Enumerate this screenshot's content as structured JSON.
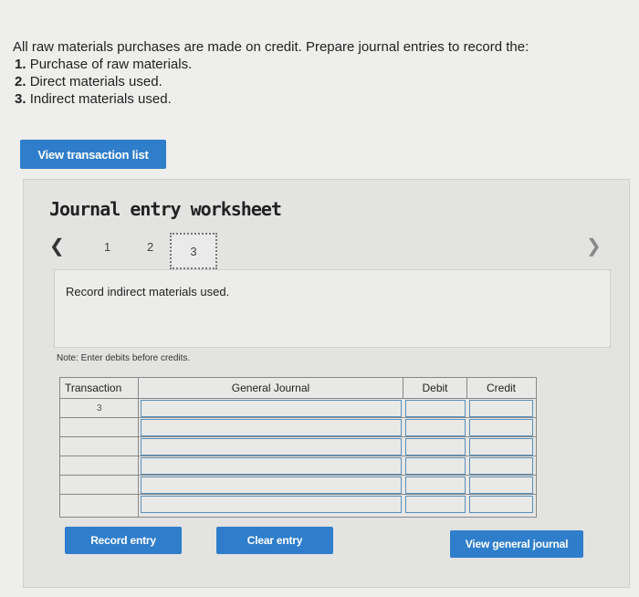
{
  "instructions": {
    "intro": "All raw materials purchases are made on credit. Prepare journal entries to record the:",
    "items": [
      {
        "num": "1.",
        "text": "Purchase of raw materials."
      },
      {
        "num": "2.",
        "text": "Direct materials used."
      },
      {
        "num": "3.",
        "text": "Indirect materials used."
      }
    ]
  },
  "view_transaction_label": "View transaction list",
  "worksheet": {
    "title": "Journal entry worksheet",
    "prev_icon": "chevron-left-icon",
    "next_icon": "chevron-right-icon",
    "pages": [
      "1",
      "2",
      "3"
    ],
    "active_page": "3",
    "prompt": "Record indirect materials used.",
    "note": "Note: Enter debits before credits."
  },
  "journal": {
    "headers": {
      "transaction": "Transaction",
      "general_journal": "General Journal",
      "debit": "Debit",
      "credit": "Credit"
    },
    "transaction_value": "3",
    "rows": 6
  },
  "buttons": {
    "record": "Record entry",
    "clear": "Clear entry",
    "view_general": "View general journal"
  },
  "colors": {
    "accent": "#2f7ecb"
  }
}
